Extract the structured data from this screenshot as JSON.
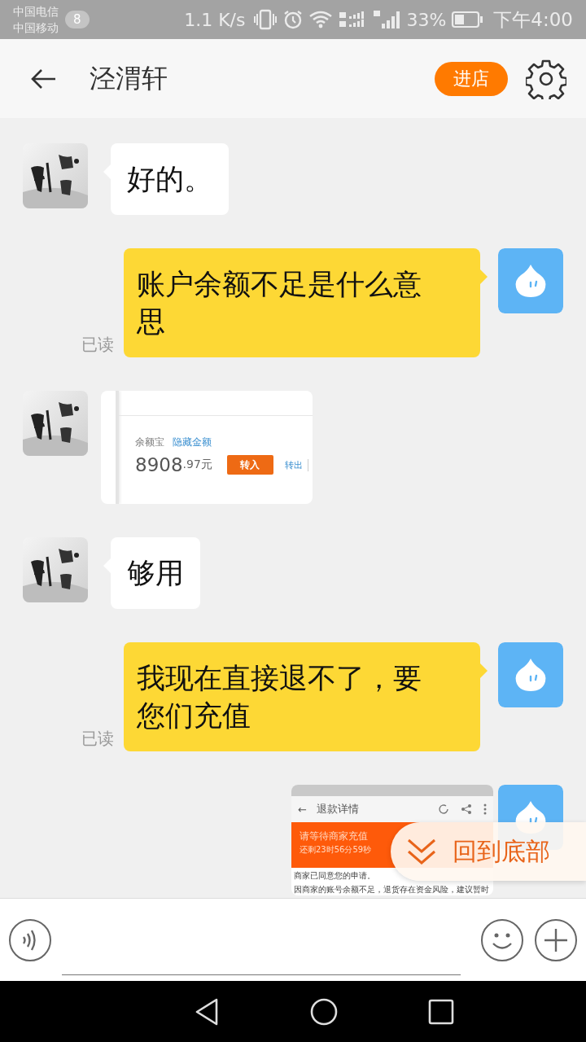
{
  "status_bar": {
    "carriers": [
      "中国电信",
      "中国移动"
    ],
    "notification_count": "8",
    "speed": "1.1 K/s",
    "battery": "33%",
    "time": "下午4:00"
  },
  "header": {
    "title": "泾渭轩",
    "shop_button": "进店"
  },
  "messages": [
    {
      "kind": "received",
      "text": "好的。"
    },
    {
      "kind": "sent",
      "text": "账户余额不足是什么意思",
      "receipt": "已读"
    },
    {
      "kind": "received",
      "screenshot": {
        "kind": "balance",
        "label": "余额宝",
        "link": "隐藏金额",
        "amount": "8908",
        "amount_decimals": ".97元",
        "button": "转入",
        "action": "转出"
      }
    },
    {
      "kind": "received",
      "text": "够用"
    },
    {
      "kind": "sent",
      "text": "我现在直接退不了，要您们充值",
      "receipt": "已读"
    },
    {
      "kind": "sent",
      "screenshot": {
        "kind": "refund",
        "back": "←",
        "title": "退款详情",
        "banner_title": "请等待商家充值",
        "countdown": "还剩23时56分59秒",
        "lines": [
          "商家已同意您的申请。",
          "因商家的账号余额不足，退货存在资金风险，建议暂时"
        ]
      }
    }
  ],
  "scroll_button": "回到底部"
}
